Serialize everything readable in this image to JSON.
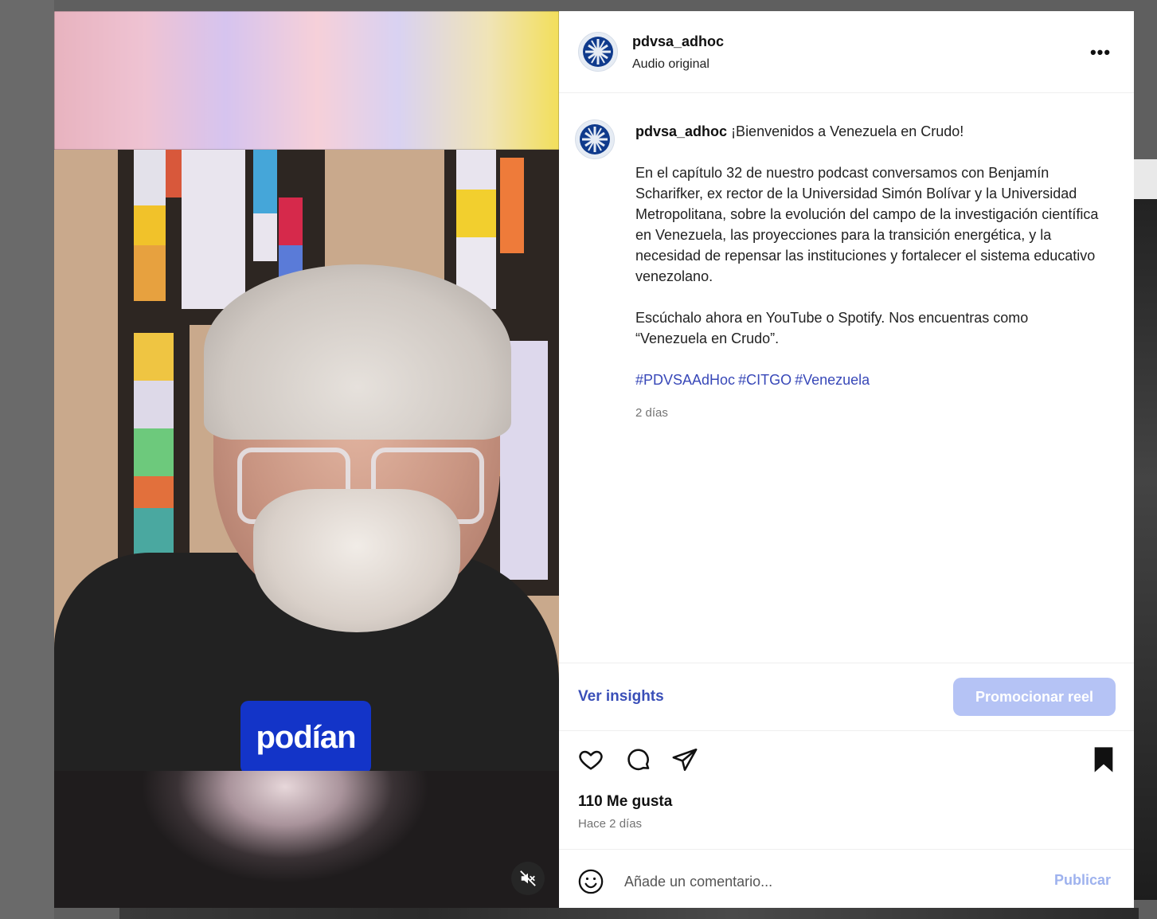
{
  "video": {
    "brand_overlay": "podían"
  },
  "post": {
    "author": "pdvsa_adhoc",
    "audio": "Audio original",
    "more_label": "•••",
    "caption": {
      "username": "pdvsa_adhoc",
      "intro": "¡Bienvenidos a Venezuela en Crudo!",
      "paragraph1": "En el capítulo 32 de nuestro podcast conversamos con Benjamín Scharifker, ex rector de la Universidad Simón Bolívar y la Universidad Metropolitana, sobre la evolución del campo de la investigación científica en Venezuela, las proyecciones para la transición energética, y la necesidad de repensar las instituciones y fortalecer el sistema educativo venezolano.",
      "paragraph2": "Escúchalo ahora en YouTube o Spotify. Nos encuentras como “Venezuela en Crudo”.",
      "hashtags": [
        "#PDVSAAdHoc",
        "#CITGO",
        "#Venezuela"
      ],
      "time_ago": "2 días"
    },
    "insights_label": "Ver insights",
    "promote_label": "Promocionar reel",
    "likes": "110 Me gusta",
    "date": "Hace 2 días",
    "comment": {
      "placeholder": "Añade un comentario...",
      "publish_label": "Publicar"
    }
  },
  "icons": {
    "avatar": "pdvsa-logo-icon",
    "like": "heart-icon",
    "comment": "comment-bubble-icon",
    "share": "paper-plane-icon",
    "save": "bookmark-filled-icon",
    "emoji": "smiley-icon",
    "mute": "speaker-muted-icon"
  },
  "colors": {
    "link": "#3a4fb8",
    "hashtag": "#3848b8",
    "promote_bg": "#b5c3f5",
    "brand_overlay_bg": "#1334c8"
  }
}
